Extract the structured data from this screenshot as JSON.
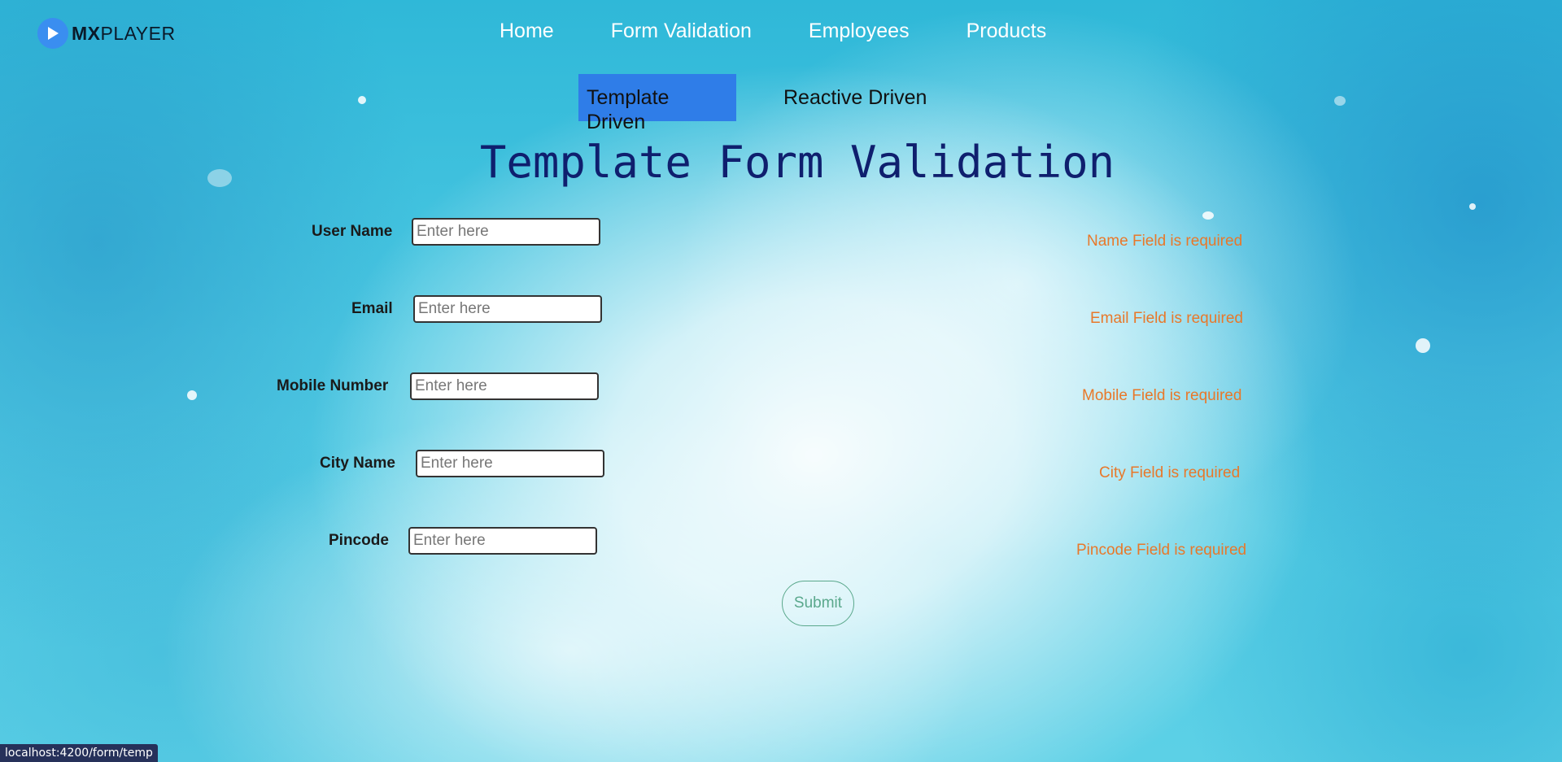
{
  "header": {
    "logo_bold": "MX",
    "logo_light": "PLAYER",
    "nav": [
      {
        "label": "Home"
      },
      {
        "label": "Form Validation"
      },
      {
        "label": "Employees"
      },
      {
        "label": "Products"
      }
    ]
  },
  "subnav": {
    "tabs": [
      {
        "label": "Template Driven",
        "active": true
      },
      {
        "label": "Reactive Driven",
        "active": false
      }
    ]
  },
  "page": {
    "title": "Template Form Validation"
  },
  "form": {
    "fields": [
      {
        "label": "User Name",
        "placeholder": "Enter here",
        "value": "",
        "error": "Name Field is required"
      },
      {
        "label": "Email",
        "placeholder": "Enter here",
        "value": "",
        "error": "Email Field is required"
      },
      {
        "label": "Mobile Number",
        "placeholder": "Enter here",
        "value": "",
        "error": "Mobile Field is required"
      },
      {
        "label": "City Name",
        "placeholder": "Enter here",
        "value": "",
        "error": "City Field is required"
      },
      {
        "label": "Pincode",
        "placeholder": "Enter here",
        "value": "",
        "error": "Pincode Field is required"
      }
    ],
    "submit_label": "Submit"
  },
  "status": {
    "url": "localhost:4200/form/temp"
  },
  "colors": {
    "accent": "#2f7de8",
    "title": "#0f1f6e",
    "error": "#e8782a",
    "submit": "#5aa88c"
  },
  "icons": {
    "logo": "play-icon"
  }
}
